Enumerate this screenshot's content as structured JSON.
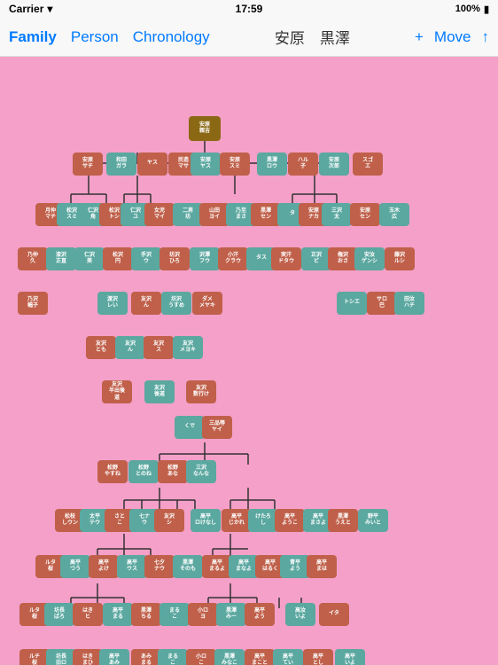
{
  "statusBar": {
    "carrier": "Carrier",
    "wifi": "WiFi",
    "time": "17:59",
    "battery": "100%"
  },
  "navBar": {
    "tabs": [
      {
        "id": "family",
        "label": "Family",
        "active": true
      },
      {
        "id": "person",
        "label": "Person",
        "active": false
      },
      {
        "id": "chronology",
        "label": "Chronology",
        "active": false
      }
    ],
    "title": "安原　黒澤",
    "actions": [
      {
        "id": "add",
        "label": "+"
      },
      {
        "id": "move",
        "label": "Move"
      },
      {
        "id": "share",
        "label": "↑"
      }
    ]
  },
  "tree": {
    "description": "Japanese family genealogy tree"
  }
}
